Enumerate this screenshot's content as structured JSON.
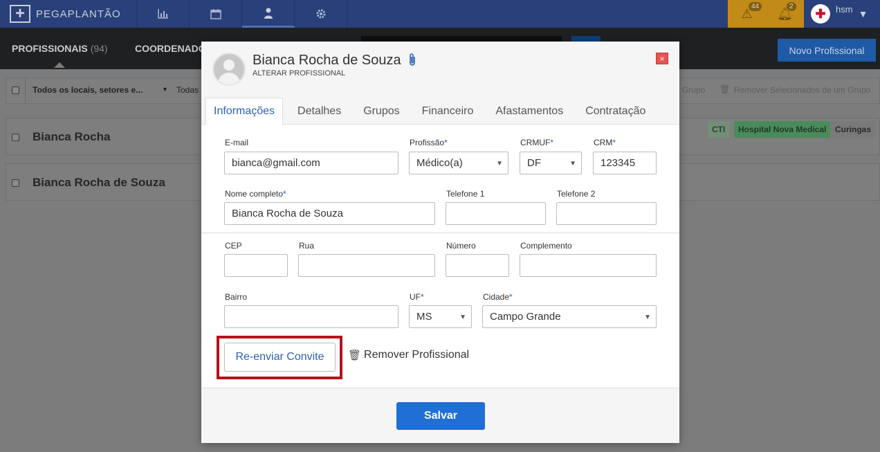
{
  "app": {
    "name": "PEGAPLANTÃO"
  },
  "topnav": {
    "alerts_count": "44",
    "notifications_count": "2",
    "user_name": "hsm"
  },
  "subnav": {
    "tab_profissionais": "PROFISSIONAIS",
    "tab_profissionais_count": "(94)",
    "tab_coordenadores": "COORDENADO",
    "new_button": "Novo Profissional"
  },
  "filter": {
    "locations": "Todos os locais, setores e...",
    "second": "Todas",
    "action_group": "Grupo",
    "action_remove": "Remover Selecionados de um Grupo"
  },
  "list": {
    "rows": [
      {
        "name": "Bianca Rocha"
      },
      {
        "name": "Bianca Rocha de Souza"
      }
    ],
    "tags": [
      "CTI",
      "Hospital Nova Medical",
      "Curingas"
    ]
  },
  "modal": {
    "title": "Bianca Rocha de Souza",
    "subtitle": "ALTERAR PROFISSIONAL",
    "close": "×",
    "tabs": [
      "Informações",
      "Detalhes",
      "Grupos",
      "Financeiro",
      "Afastamentos",
      "Contratação"
    ],
    "form": {
      "email_label": "E-mail",
      "email_value": "bianca@gmail.com",
      "profissao_label": "Profissão",
      "profissao_value": "Médico(a)",
      "crmuf_label": "CRMUF",
      "crmuf_value": "DF",
      "crm_label": "CRM",
      "crm_value": "123345",
      "nome_label": "Nome completo",
      "nome_value": "Bianca Rocha de Souza",
      "tel1_label": "Telefone 1",
      "tel2_label": "Telefone 2",
      "cep_label": "CEP",
      "rua_label": "Rua",
      "numero_label": "Número",
      "complemento_label": "Complemento",
      "bairro_label": "Bairro",
      "uf_label": "UF",
      "uf_value": "MS",
      "cidade_label": "Cidade",
      "cidade_value": "Campo Grande",
      "required_mark": "*"
    },
    "resend_button": "Re-enviar Convite",
    "remove_button": "Remover Profissional",
    "save_button": "Salvar"
  },
  "colors": {
    "brand_blue": "#29407a",
    "accent_blue": "#1f6fd6",
    "alert_amber": "#c28b18",
    "highlight_red": "#b5121b"
  }
}
